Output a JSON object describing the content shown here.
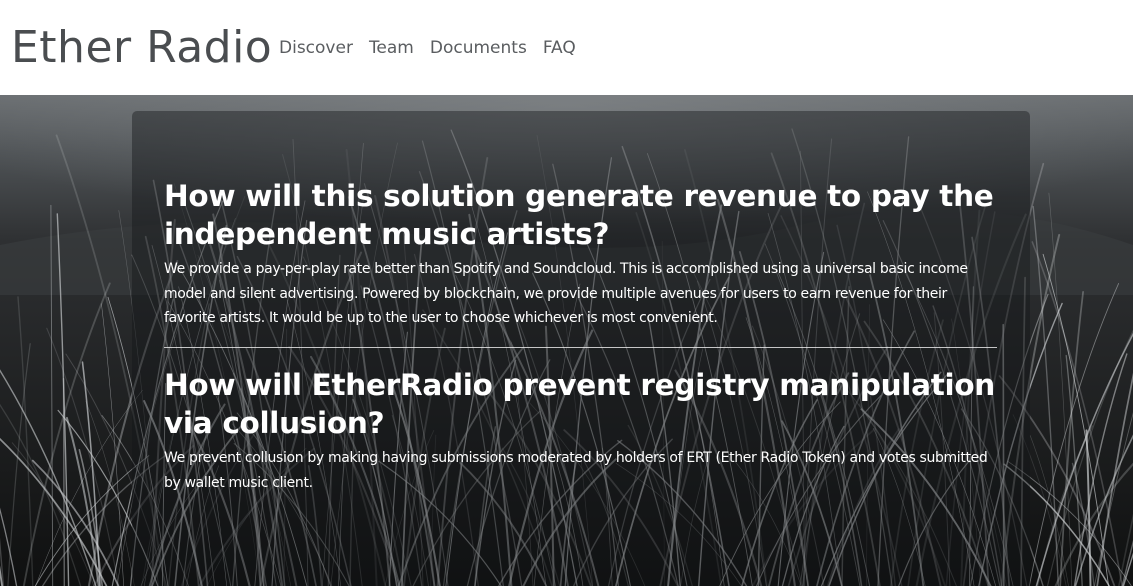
{
  "brand": "Ether Radio",
  "nav": {
    "items": [
      {
        "label": "Discover"
      },
      {
        "label": "Team"
      },
      {
        "label": "Documents"
      },
      {
        "label": "FAQ"
      }
    ]
  },
  "faq": {
    "items": [
      {
        "question": "How will this solution generate revenue to pay the independent music artists?",
        "answer": "We provide a pay-per-play rate better than Spotify and Soundcloud. This is accomplished using a universal basic income model and silent advertising. Powered by blockchain, we provide multiple avenues for users to earn revenue for their favorite artists. It would be up to the user to choose whichever is most convenient."
      },
      {
        "question": "How will EtherRadio prevent registry manipulation via collusion?",
        "answer": "We prevent collusion by making having submissions moderated by holders of ERT (Ether Radio Token) and votes submitted by wallet music client."
      }
    ]
  },
  "colors": {
    "brand_text": "#4a4d50",
    "nav_text": "#5a5d60",
    "hero_text": "#ffffff"
  }
}
